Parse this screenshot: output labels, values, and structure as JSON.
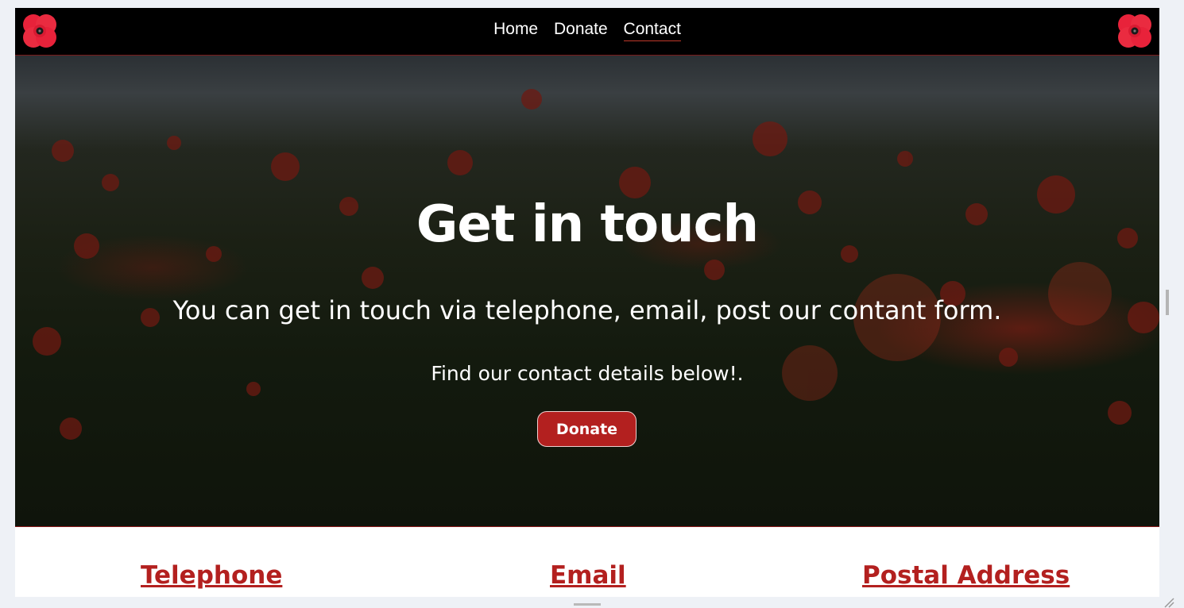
{
  "nav": {
    "links": [
      {
        "label": "Home",
        "active": false
      },
      {
        "label": "Donate",
        "active": false
      },
      {
        "label": "Contact",
        "active": true
      }
    ]
  },
  "hero": {
    "title": "Get in touch",
    "subtitle": "You can get in touch via telephone, email, post our contant form.",
    "find_text": "Find our contact details below!.",
    "button_label": "Donate"
  },
  "contact": {
    "telephone_heading": "Telephone",
    "email_heading": "Email",
    "postal_heading": "Postal Address"
  },
  "colors": {
    "navbar": "#000000",
    "accent": "#b3201f",
    "poppy": "#e8223a"
  }
}
